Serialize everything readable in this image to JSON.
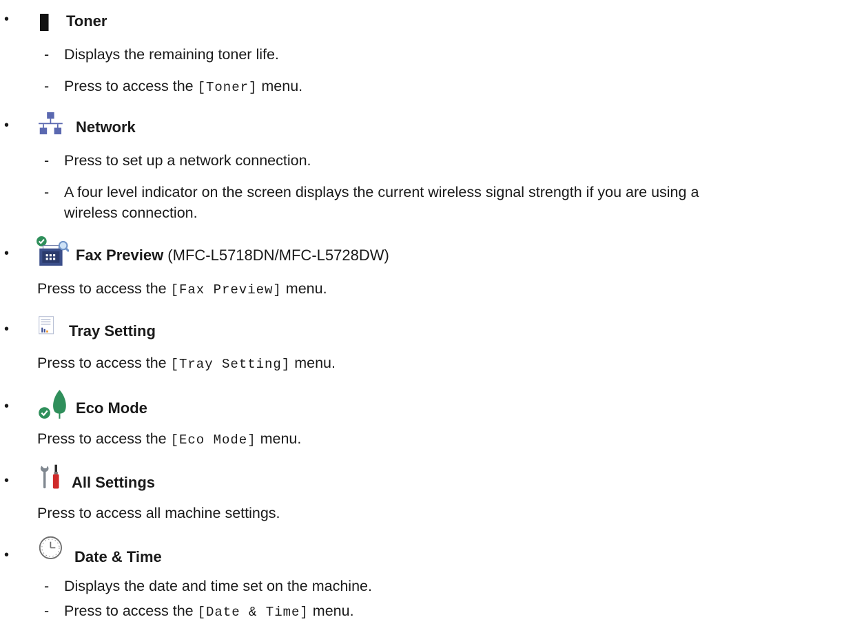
{
  "items": [
    {
      "title": "Toner",
      "lines": [
        {
          "text": "Displays the remaining toner life."
        },
        {
          "pre": "Press to access the ",
          "code": "[Toner]",
          "post": " menu."
        }
      ]
    },
    {
      "title": "Network",
      "lines": [
        {
          "text": "Press to set up a network connection."
        },
        {
          "text": "A four level indicator on the screen displays the current wireless signal strength if you are using a",
          "text2": "wireless connection."
        }
      ]
    },
    {
      "title": "Fax Preview",
      "title_note": " (MFC-L5718DN/MFC-L5728DW)",
      "para": {
        "pre": "Press to access the ",
        "code": "[Fax Preview]",
        "post": " menu."
      }
    },
    {
      "title": "Tray Setting",
      "para": {
        "pre": "Press to access the ",
        "code": "[Tray Setting]",
        "post": " menu."
      }
    },
    {
      "title": "Eco Mode",
      "para": {
        "pre": "Press to access the ",
        "code": "[Eco Mode]",
        "post": " menu."
      }
    },
    {
      "title": "All Settings",
      "para": {
        "text": "Press to access all machine settings."
      }
    },
    {
      "title": "Date & Time",
      "lines": [
        {
          "text": "Displays the date and time set on the machine."
        },
        {
          "pre": "Press to access the ",
          "code": "[Date & Time]",
          "post": " menu."
        }
      ]
    }
  ],
  "bullet": "•",
  "dash": "-",
  "icons": [
    "toner-icon",
    "network-icon",
    "fax-preview-icon",
    "tray-setting-icon",
    "eco-mode-icon",
    "all-settings-icon",
    "date-time-icon"
  ]
}
